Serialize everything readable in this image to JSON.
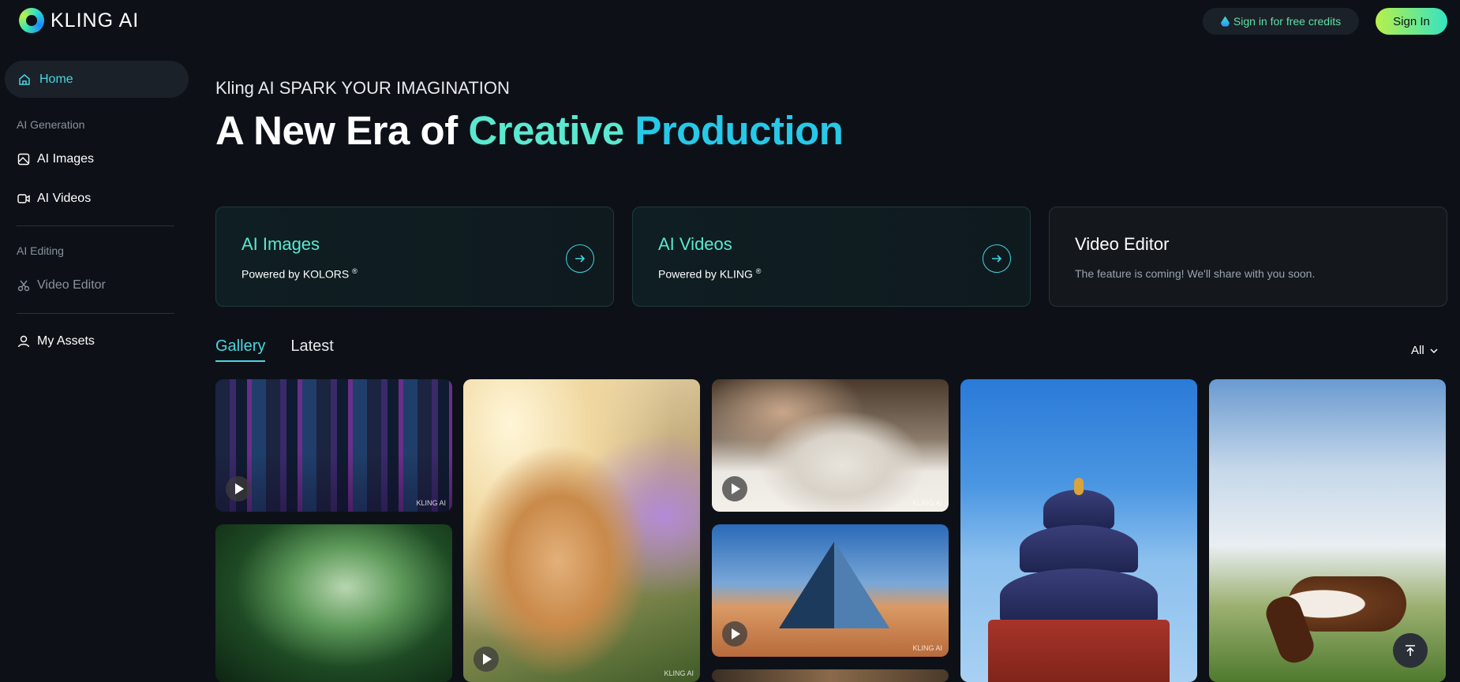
{
  "app": {
    "logo_text": "KLING AI",
    "colors": {
      "accent": "#49d6e0",
      "accent_alt": "#5be8d0",
      "brand_green": "#b9f04a",
      "background": "#0d1117"
    }
  },
  "header": {
    "credits_label": "Sign in for free credits",
    "signin_label": "Sign In"
  },
  "sidebar": {
    "home": "Home",
    "section_generation": "AI Generation",
    "ai_images": "AI Images",
    "ai_videos": "AI Videos",
    "section_editing": "AI Editing",
    "video_editor": "Video Editor",
    "my_assets": "My Assets"
  },
  "hero": {
    "kicker": "Kling AI SPARK YOUR IMAGINATION",
    "headline_part1": "A New Era of ",
    "headline_part2": "Creative ",
    "headline_part3": "Production"
  },
  "cards": [
    {
      "title": "AI Images",
      "subtitle": "Powered by KOLORS",
      "mark": "®",
      "icon": "arrow-right-icon"
    },
    {
      "title": "AI Videos",
      "subtitle": "Powered by KLING",
      "mark": "®",
      "icon": "arrow-right-icon"
    },
    {
      "title": "Video Editor",
      "subtitle": "The feature is coming! We'll share with you soon."
    }
  ],
  "gallery": {
    "tabs": [
      "Gallery",
      "Latest"
    ],
    "active_tab": "Gallery",
    "filter_value": "All",
    "watermark": "KLING AI"
  }
}
